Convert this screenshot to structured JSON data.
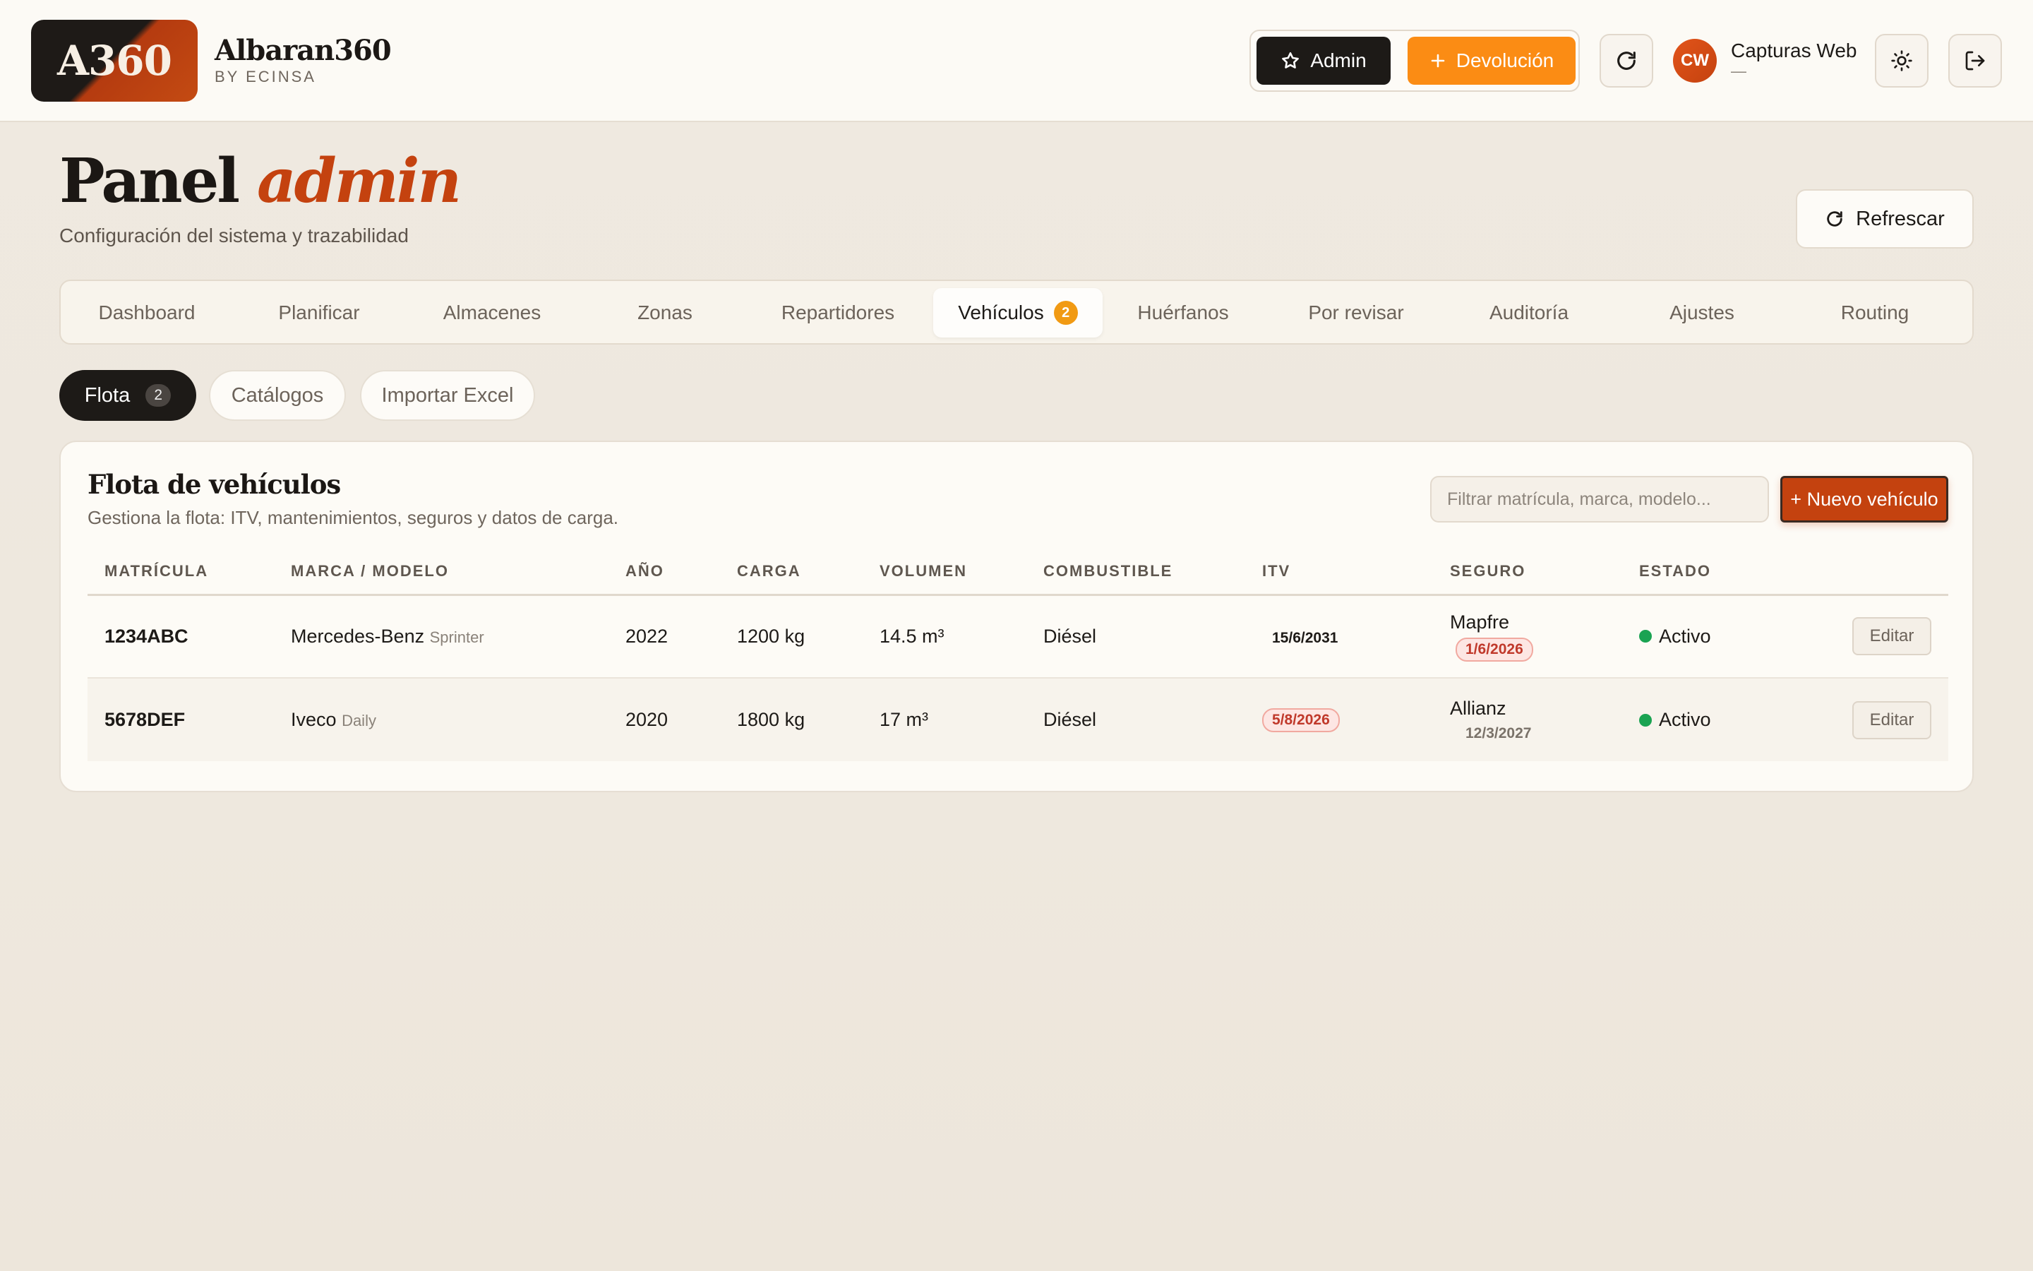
{
  "brand": {
    "logo_text": "A360",
    "name": "Albaran360",
    "sub": "BY ECINSA"
  },
  "header_actions": {
    "admin_label": "Admin",
    "devolucion_label": "Devolución",
    "user_initials": "CW",
    "user_name": "Capturas Web",
    "user_sub": "—"
  },
  "page": {
    "title_main": "Panel",
    "title_accent": "admin",
    "subtitle": "Configuración del sistema y trazabilidad",
    "refresh_label": "Refrescar"
  },
  "tabs": [
    {
      "label": "Dashboard"
    },
    {
      "label": "Planificar"
    },
    {
      "label": "Almacenes"
    },
    {
      "label": "Zonas"
    },
    {
      "label": "Repartidores"
    },
    {
      "label": "Vehículos",
      "badge": "2",
      "active": true
    },
    {
      "label": "Huérfanos"
    },
    {
      "label": "Por revisar"
    },
    {
      "label": "Auditoría"
    },
    {
      "label": "Ajustes"
    },
    {
      "label": "Routing"
    }
  ],
  "subtabs": [
    {
      "label": "Flota",
      "count": "2",
      "active": true
    },
    {
      "label": "Catálogos"
    },
    {
      "label": "Importar Excel"
    }
  ],
  "fleet": {
    "title": "Flota de vehículos",
    "subtitle": "Gestiona la flota: ITV, mantenimientos, seguros y datos de carga.",
    "filter_placeholder": "Filtrar matrícula, marca, modelo...",
    "new_button": "+ Nuevo vehículo",
    "columns": [
      "MATRÍCULA",
      "MARCA / MODELO",
      "AÑO",
      "CARGA",
      "VOLUMEN",
      "COMBUSTIBLE",
      "ITV",
      "SEGURO",
      "ESTADO"
    ],
    "rows": [
      {
        "plate": "1234ABC",
        "brand": "Mercedes-Benz",
        "model": "Sprinter",
        "year": "2022",
        "load": "1200 kg",
        "volume": "14.5 m³",
        "fuel": "Diésel",
        "itv": "15/6/2031",
        "insurer": "Mapfre",
        "insurance_date": "1/6/2026",
        "status": "Activo",
        "edit": "Editar"
      },
      {
        "plate": "5678DEF",
        "brand": "Iveco",
        "model": "Daily",
        "year": "2020",
        "load": "1800 kg",
        "volume": "17 m³",
        "fuel": "Diésel",
        "itv": "5/8/2026",
        "insurer": "Allianz",
        "insurance_date": "12/3/2027",
        "status": "Activo",
        "edit": "Editar"
      }
    ]
  },
  "colors": {
    "accent": "#c4420f",
    "orange": "#fb8c14",
    "badge": "#f19a13",
    "dark": "#1d1a17",
    "status_active": "#1aa352",
    "warn": "#c0392b"
  }
}
